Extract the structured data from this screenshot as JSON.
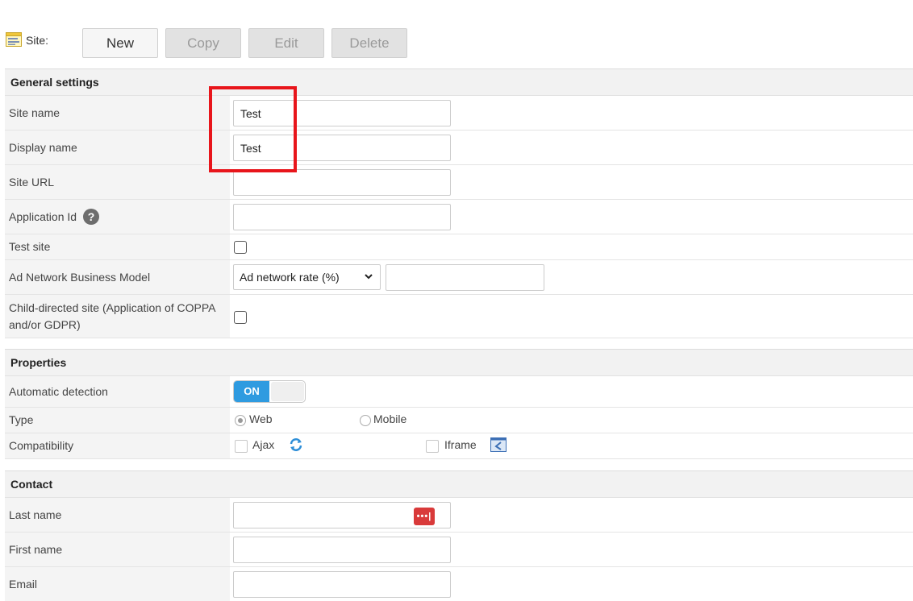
{
  "toolbar": {
    "site_label": "Site:",
    "buttons": {
      "new": "New",
      "copy": "Copy",
      "edit": "Edit",
      "delete": "Delete"
    }
  },
  "general": {
    "title": "General settings",
    "site_name": {
      "label": "Site name",
      "value": "Test"
    },
    "display_name": {
      "label": "Display name",
      "value": "Test"
    },
    "site_url": {
      "label": "Site URL",
      "value": ""
    },
    "application_id": {
      "label": "Application Id",
      "help": "?",
      "value": ""
    },
    "test_site": {
      "label": "Test site",
      "checked": false
    },
    "ad_network": {
      "label": "Ad Network Business Model",
      "selected": "Ad network rate (%)",
      "value": ""
    },
    "child_directed": {
      "label": "Child-directed site (Application of COPPA and/or GDPR)",
      "checked": false
    }
  },
  "properties": {
    "title": "Properties",
    "automatic_detection": {
      "label": "Automatic detection",
      "toggle": "ON"
    },
    "type": {
      "label": "Type",
      "options": [
        "Web",
        "Mobile"
      ],
      "selected": "Web"
    },
    "compatibility": {
      "label": "Compatibility",
      "options": [
        "Ajax",
        "Iframe"
      ]
    }
  },
  "contact": {
    "title": "Contact",
    "last_name": {
      "label": "Last name",
      "value": "",
      "pw_icon": "•••|"
    },
    "first_name": {
      "label": "First name",
      "value": ""
    },
    "email": {
      "label": "Email",
      "value": ""
    }
  },
  "colors": {
    "highlight": "#e8151b",
    "toggle_on": "#2f9be0",
    "password_icon": "#d93a3a"
  }
}
